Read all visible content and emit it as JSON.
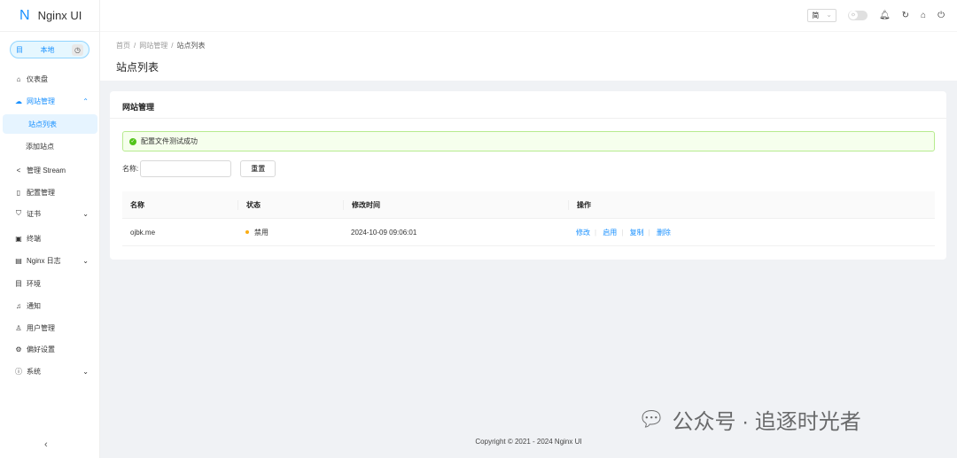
{
  "app": {
    "logo_letter": "N",
    "name": "Nginx UI"
  },
  "env": {
    "label": "本地"
  },
  "sidebar": {
    "items": [
      {
        "label": "仪表盘"
      },
      {
        "label": "网站管理"
      },
      {
        "label": "站点列表"
      },
      {
        "label": "添加站点"
      },
      {
        "label": "管理 Stream"
      },
      {
        "label": "配置管理"
      },
      {
        "label": "证书"
      },
      {
        "label": "终端"
      },
      {
        "label": "Nginx 日志"
      },
      {
        "label": "环境"
      },
      {
        "label": "通知"
      },
      {
        "label": "用户管理"
      },
      {
        "label": "偏好设置"
      },
      {
        "label": "系统"
      }
    ]
  },
  "header": {
    "lang": "简"
  },
  "breadcrumb": [
    "首页",
    "网站管理",
    "站点列表"
  ],
  "page_title": "站点列表",
  "card": {
    "title": "网站管理",
    "alert": "配置文件测试成功",
    "search_label": "名称:",
    "search_value": "",
    "reset": "重置"
  },
  "table": {
    "columns": [
      "名称",
      "状态",
      "修改时间",
      "操作"
    ],
    "rows": [
      {
        "name": "ojbk.me",
        "status": "禁用",
        "status_color": "#faad14",
        "modified": "2024-10-09 09:06:01",
        "actions": [
          "修改",
          "启用",
          "复制",
          "删除"
        ]
      }
    ]
  },
  "footer": "Copyright © 2021 - 2024 Nginx UI",
  "watermark": "公众号 · 追逐时光者"
}
